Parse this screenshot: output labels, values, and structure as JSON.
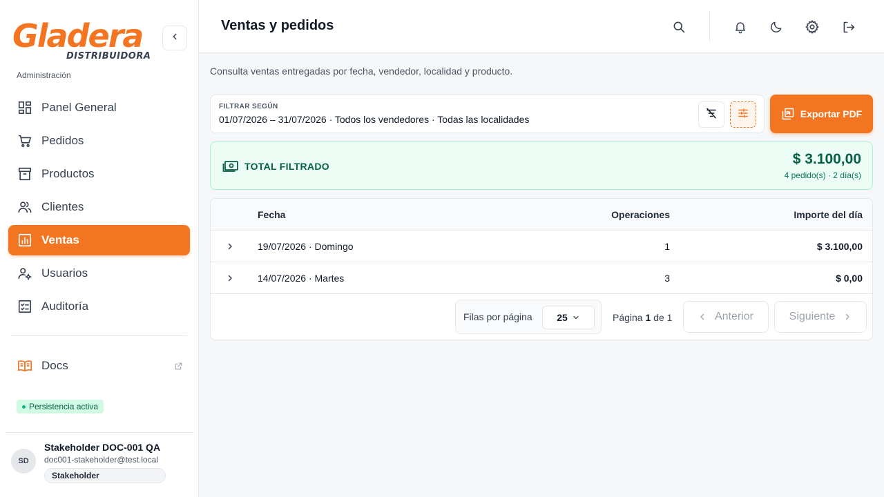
{
  "brand": {
    "name": "Gladera",
    "tagline": "DISTRIBUIDORA",
    "accent": "#f47521"
  },
  "sidebar": {
    "section_label": "Administración",
    "items": [
      {
        "label": "Panel General",
        "icon": "dashboard-icon",
        "active": false
      },
      {
        "label": "Pedidos",
        "icon": "cart-icon",
        "active": false
      },
      {
        "label": "Productos",
        "icon": "archive-icon",
        "active": false
      },
      {
        "label": "Clientes",
        "icon": "users-icon",
        "active": false
      },
      {
        "label": "Ventas",
        "icon": "chart-icon",
        "active": true
      },
      {
        "label": "Usuarios",
        "icon": "user-gear-icon",
        "active": false
      },
      {
        "label": "Auditoría",
        "icon": "checklist-icon",
        "active": false
      }
    ],
    "docs_label": "Docs",
    "status_badge": "Persistencia activa",
    "user": {
      "initials": "SD",
      "name": "Stakeholder DOC-001 QA",
      "email": "doc001-stakeholder@test.local",
      "role": "Stakeholder"
    }
  },
  "header": {
    "title": "Ventas y pedidos",
    "icons": [
      "search-icon",
      "bell-icon",
      "moon-icon",
      "gear-icon",
      "logout-icon"
    ]
  },
  "main": {
    "subtitle": "Consulta ventas entregadas por fecha, vendedor, localidad y producto.",
    "filter": {
      "label": "FILTRAR SEGÚN",
      "value": "01/07/2026 – 31/07/2026 · Todos los vendedores · Todas las localidades"
    },
    "export_label": "Exportar PDF",
    "total": {
      "label": "TOTAL FILTRADO",
      "amount": "$ 3.100,00",
      "meta": "4 pedido(s) · 2 día(s)"
    },
    "table": {
      "columns": [
        "Fecha",
        "Operaciones",
        "Importe del día"
      ],
      "rows": [
        {
          "fecha": "19/07/2026 · Domingo",
          "operaciones": "1",
          "importe": "$ 3.100,00"
        },
        {
          "fecha": "14/07/2026 · Martes",
          "operaciones": "3",
          "importe": "$ 0,00"
        }
      ]
    },
    "pagination": {
      "rows_label": "Filas por página",
      "rows_value": "25",
      "page_prefix": "Página",
      "page_current": "1",
      "page_sep": "de",
      "page_total": "1",
      "prev_label": "Anterior",
      "next_label": "Siguiente"
    }
  }
}
